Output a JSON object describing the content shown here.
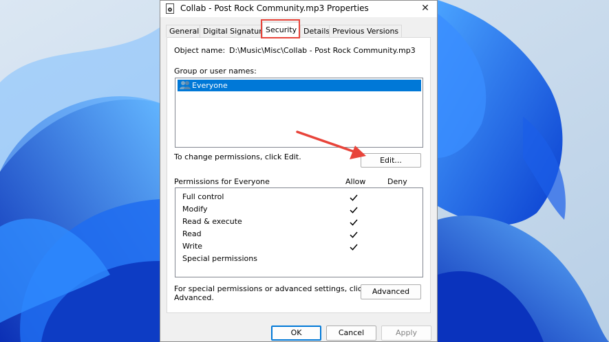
{
  "window": {
    "title": "Collab - Post Rock Community.mp3 Properties",
    "close_glyph": "✕"
  },
  "tabs": [
    {
      "label": "General",
      "active": false
    },
    {
      "label": "Digital Signatures",
      "active": false
    },
    {
      "label": "Security",
      "active": true
    },
    {
      "label": "Details",
      "active": false
    },
    {
      "label": "Previous Versions",
      "active": false
    }
  ],
  "security": {
    "object_name_label": "Object name:",
    "object_name_value": "D:\\Music\\Misc\\Collab - Post Rock Community.mp3",
    "group_label": "Group or user names:",
    "groups": [
      {
        "name": "Everyone",
        "icon": "users-icon",
        "selected": true
      }
    ],
    "change_hint": "To change permissions, click Edit.",
    "edit_button": "Edit...",
    "permissions_label": "Permissions for Everyone",
    "allow_header": "Allow",
    "deny_header": "Deny",
    "permissions": [
      {
        "name": "Full control",
        "allow": true,
        "deny": false
      },
      {
        "name": "Modify",
        "allow": true,
        "deny": false
      },
      {
        "name": "Read & execute",
        "allow": true,
        "deny": false
      },
      {
        "name": "Read",
        "allow": true,
        "deny": false
      },
      {
        "name": "Write",
        "allow": true,
        "deny": false
      },
      {
        "name": "Special permissions",
        "allow": false,
        "deny": false
      }
    ],
    "advanced_hint_line1": "For special permissions or advanced settings, click",
    "advanced_hint_line2": "Advanced.",
    "advanced_button": "Advanced"
  },
  "footer": {
    "ok": "OK",
    "cancel": "Cancel",
    "apply": "Apply"
  },
  "colors": {
    "selection": "#0078d7",
    "annotation": "#e8443a"
  }
}
